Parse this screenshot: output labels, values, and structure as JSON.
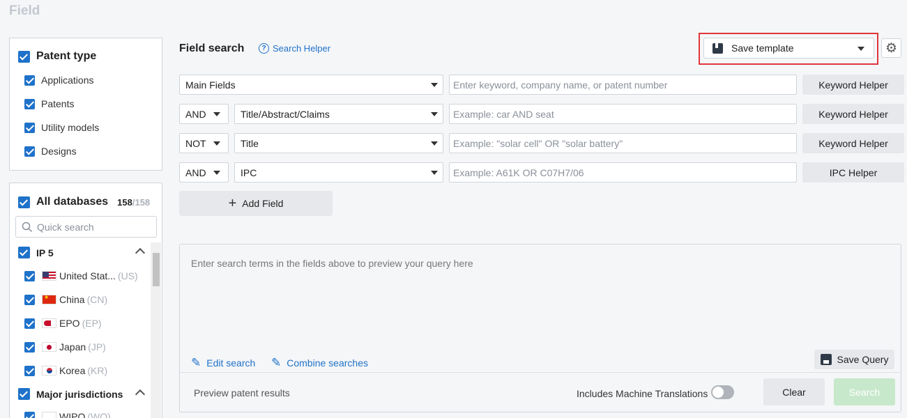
{
  "page": {
    "title": "Field"
  },
  "patent_type": {
    "title": "Patent type",
    "items": [
      {
        "label": "Applications"
      },
      {
        "label": "Patents"
      },
      {
        "label": "Utility models"
      },
      {
        "label": "Designs"
      }
    ]
  },
  "databases": {
    "title": "All databases",
    "count_selected": "158",
    "count_total": "/158",
    "search_placeholder": "Quick search",
    "group_ip5": {
      "title": "IP 5",
      "items": [
        {
          "name": "United Stat...",
          "code": "(US)"
        },
        {
          "name": "China",
          "code": "(CN)"
        },
        {
          "name": "EPO",
          "code": "(EP)"
        },
        {
          "name": "Japan",
          "code": "(JP)"
        },
        {
          "name": "Korea",
          "code": "(KR)"
        }
      ]
    },
    "group_major": {
      "title": "Major jurisdictions",
      "items": [
        {
          "name": "WIPO",
          "code": "(WO)"
        }
      ]
    }
  },
  "field_search": {
    "title": "Field search",
    "helper_link": "Search Helper",
    "save_template": "Save template",
    "rows": [
      {
        "operator": "",
        "field": "Main Fields",
        "placeholder": "Enter keyword, company name, or patent number",
        "helper": "Keyword Helper"
      },
      {
        "operator": "AND",
        "field": "Title/Abstract/Claims",
        "placeholder": "Example: car AND seat",
        "helper": "Keyword Helper"
      },
      {
        "operator": "NOT",
        "field": "Title",
        "placeholder": "Example: \"solar cell\" OR \"solar battery\"",
        "helper": "Keyword Helper"
      },
      {
        "operator": "AND",
        "field": "IPC",
        "placeholder": "Example: A61K OR C07H7/06",
        "helper": "IPC Helper"
      }
    ],
    "add_field": "Add Field"
  },
  "preview": {
    "placeholder": "Enter search terms in the fields above to preview your query here",
    "edit_search": "Edit search",
    "combine_searches": "Combine searches",
    "save_query": "Save Query",
    "preview_results": "Preview patent results",
    "machine_translations": "Includes Machine Translations",
    "clear": "Clear",
    "search": "Search"
  },
  "icons": {
    "question": "?",
    "gear": "⚙",
    "plus": "+",
    "pencil": "✎"
  },
  "colors": {
    "accent": "#1f72c9",
    "highlight": "#e0363b",
    "search_disabled": "#c7e8cb"
  }
}
